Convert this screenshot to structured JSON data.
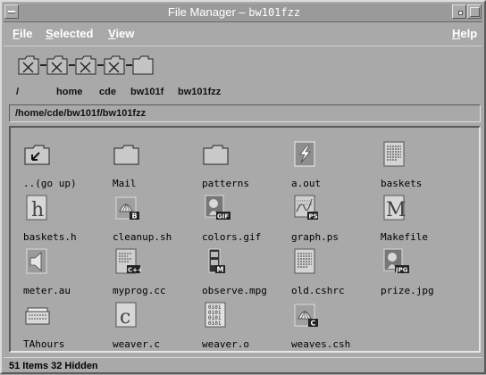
{
  "window": {
    "title": "File Manager –",
    "folder": "bw101fzz"
  },
  "menubar": {
    "file_key": "F",
    "file_rest": "ile",
    "selected_key": "S",
    "selected_rest": "elected",
    "view_key": "V",
    "view_rest": "iew",
    "help_key": "H",
    "help_rest": "elp"
  },
  "iconic_path": {
    "labels": [
      "/",
      "home",
      "cde",
      "bw101f",
      "bw101fzz"
    ]
  },
  "path_field": "/home/cde/bw101f/bw101fzz",
  "files": [
    {
      "name": "..(go up)",
      "icon": "go-up-folder-icon"
    },
    {
      "name": "Mail",
      "icon": "folder-icon"
    },
    {
      "name": "patterns",
      "icon": "folder-icon"
    },
    {
      "name": "a.out",
      "icon": "executable-icon"
    },
    {
      "name": "baskets",
      "icon": "text-file-icon"
    },
    {
      "name": "baskets.h",
      "icon": "header-file-icon"
    },
    {
      "name": "cleanup.sh",
      "icon": "shell-script-icon"
    },
    {
      "name": "colors.gif",
      "icon": "gif-image-icon"
    },
    {
      "name": "graph.ps",
      "icon": "postscript-icon"
    },
    {
      "name": "Makefile",
      "icon": "makefile-icon"
    },
    {
      "name": "meter.au",
      "icon": "audio-file-icon"
    },
    {
      "name": "myprog.cc",
      "icon": "cplusplus-file-icon"
    },
    {
      "name": "observe.mpg",
      "icon": "movie-file-icon"
    },
    {
      "name": "old.cshrc",
      "icon": "text-file-icon"
    },
    {
      "name": "prize.jpg",
      "icon": "jpg-image-icon"
    },
    {
      "name": "TAhours",
      "icon": "calendar-file-icon"
    },
    {
      "name": "weaver.c",
      "icon": "c-source-icon"
    },
    {
      "name": "weaver.o",
      "icon": "object-file-icon"
    },
    {
      "name": "weaves.csh",
      "icon": "csh-script-icon"
    }
  ],
  "file_badges": {
    "cleanup_sh": "B",
    "colors_gif": "GIF",
    "graph_ps": "PS",
    "myprog_cc": "C++",
    "observe_mpg": "M",
    "prize_jpg": "JPG",
    "weaves_csh": "C",
    "weaver_o": "0101\n0101\n0101\n0101",
    "header_h": "h",
    "makefile_m": "M",
    "source_c": "c",
    "executable": "⚡"
  },
  "status": "51 Items 32 Hidden"
}
